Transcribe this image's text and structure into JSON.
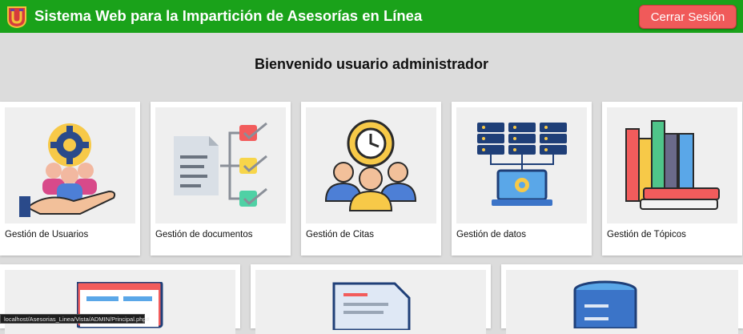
{
  "header": {
    "title": "Sistema Web para la Impartición de Asesorías en Línea",
    "logout_label": "Cerrar Sesión",
    "bg_color": "#1aa21a",
    "logout_color": "#f05a5a"
  },
  "welcome": "Bienvenido usuario administrador",
  "cards": [
    {
      "label": "Gestión de Usuarios",
      "icon": "users-management-icon"
    },
    {
      "label": "Gestión de documentos",
      "icon": "documents-checklist-icon"
    },
    {
      "label": "Gestión de Citas",
      "icon": "appointments-clock-icon"
    },
    {
      "label": "Gestión de datos",
      "icon": "database-servers-icon"
    },
    {
      "label": "Gestión de Tópicos",
      "icon": "books-topics-icon"
    }
  ],
  "cards_row2": [
    {
      "icon": "web-page-icon"
    },
    {
      "icon": "document-file-icon"
    },
    {
      "icon": "database-icon"
    }
  ],
  "status_url": "localhost/Asesorias_Linea/Vista/ADMIN/Principal.php#"
}
